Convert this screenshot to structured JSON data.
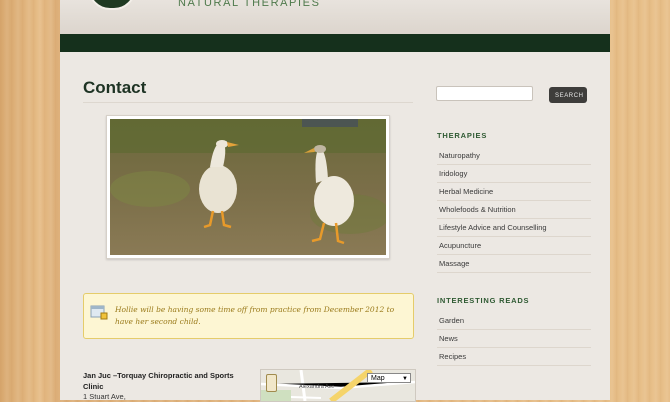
{
  "header": {
    "logo_text": "NATURAL THERAPIES"
  },
  "main": {
    "title": "Contact",
    "notice": "Hollie will be having some time off from practice from December 2012 to have her second child.",
    "address": {
      "name": "Jan Juc –Torquay Chiropractic and Sports Clinic",
      "street": "1 Stuart Ave,"
    },
    "map": {
      "type_label": "Map",
      "street_labels": [
        "Alexandra Ave"
      ]
    }
  },
  "sidebar": {
    "search": {
      "placeholder": "",
      "button_label": "SEARCH"
    },
    "therapies": {
      "heading": "THERAPIES",
      "items": [
        "Naturopathy",
        "Iridology",
        "Herbal Medicine",
        "Wholefoods & Nutrition",
        "Lifestyle Advice and Counselling",
        "Acupuncture",
        "Massage"
      ]
    },
    "reads": {
      "heading": "INTERESTING READS",
      "items": [
        "Garden",
        "News",
        "Recipes"
      ]
    }
  },
  "colors": {
    "nav": "#15301c",
    "accent_green": "#2f5a33",
    "notice_bg": "#fdf6d3"
  },
  "icons": [
    "notice-icon",
    "pegman-icon"
  ]
}
